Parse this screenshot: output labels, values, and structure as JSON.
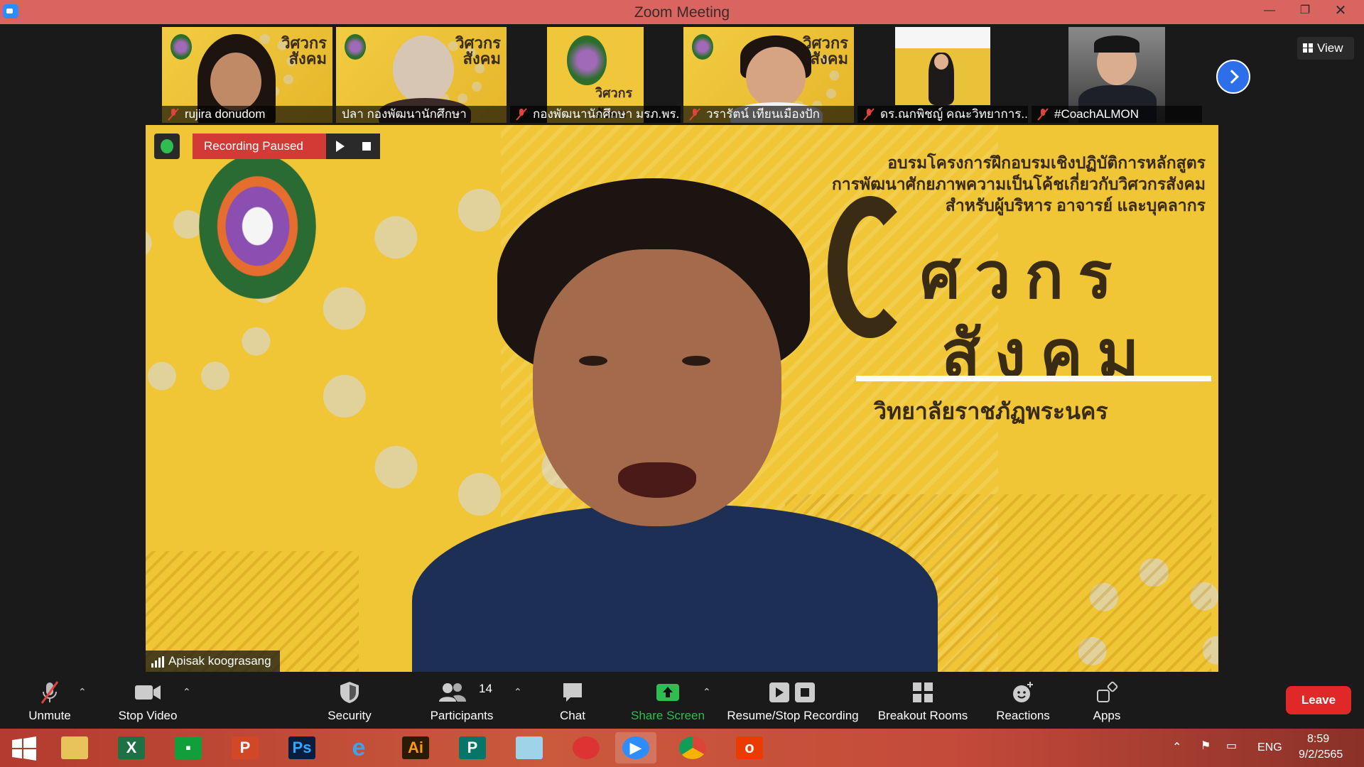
{
  "window": {
    "title": "Zoom Meeting"
  },
  "thumbnails": [
    {
      "name": "rujira donudom",
      "muted": true
    },
    {
      "name": "ปลา กองพัฒนานักศึกษา",
      "muted": false
    },
    {
      "name": "กองพัฒนานักศึกษา มรภ.พร...",
      "muted": true
    },
    {
      "name": "วรารัตน์ เทียนเมืองปัก",
      "muted": true
    },
    {
      "name": "ดร.ณกพิชญ์ คณะวิทยาการ...",
      "muted": true
    },
    {
      "name": "#CoachALMON",
      "muted": true
    }
  ],
  "thumb_brand": "วิศวกร สังคม",
  "view_label": "View",
  "recording": {
    "status": "Recording Paused"
  },
  "slide": {
    "headline_lines": [
      "อบรมโครงการฝึกอบรมเชิงปฏิบัติการหลักสูตร",
      "การพัฒนาศักยภาพความเป็นโค้ชเกี่ยวกับวิศวกรสังคม",
      "สำหรับผู้บริหาร อาจารย์ และบุคลากร"
    ],
    "brand_line1": "ศวกร",
    "brand_line2": "สังคม",
    "university": "วิทยาลัยราชภัฏพระนคร"
  },
  "active_speaker": {
    "name": "Apisak koograsang"
  },
  "toolbar": {
    "unmute": "Unmute",
    "stop_video": "Stop Video",
    "security": "Security",
    "participants": "Participants",
    "participants_count": "14",
    "chat": "Chat",
    "share_screen": "Share Screen",
    "recording": "Resume/Stop Recording",
    "breakout": "Breakout Rooms",
    "reactions": "Reactions",
    "apps": "Apps",
    "leave": "Leave"
  },
  "taskbar": {
    "apps": [
      "start",
      "file-explorer",
      "excel",
      "store",
      "powerpoint",
      "photoshop",
      "internet-explorer",
      "illustrator",
      "publisher",
      "notepad",
      "photoscape",
      "zoom",
      "chrome",
      "office"
    ],
    "ps_label": "Ps",
    "ai_label": "Ai",
    "language": "ENG",
    "time": "8:59",
    "date": "9/2/2565"
  },
  "colors": {
    "titlebar": "#d8655f",
    "leave": "#e02828",
    "share": "#2fbd4f",
    "recording": "#d33a36"
  }
}
